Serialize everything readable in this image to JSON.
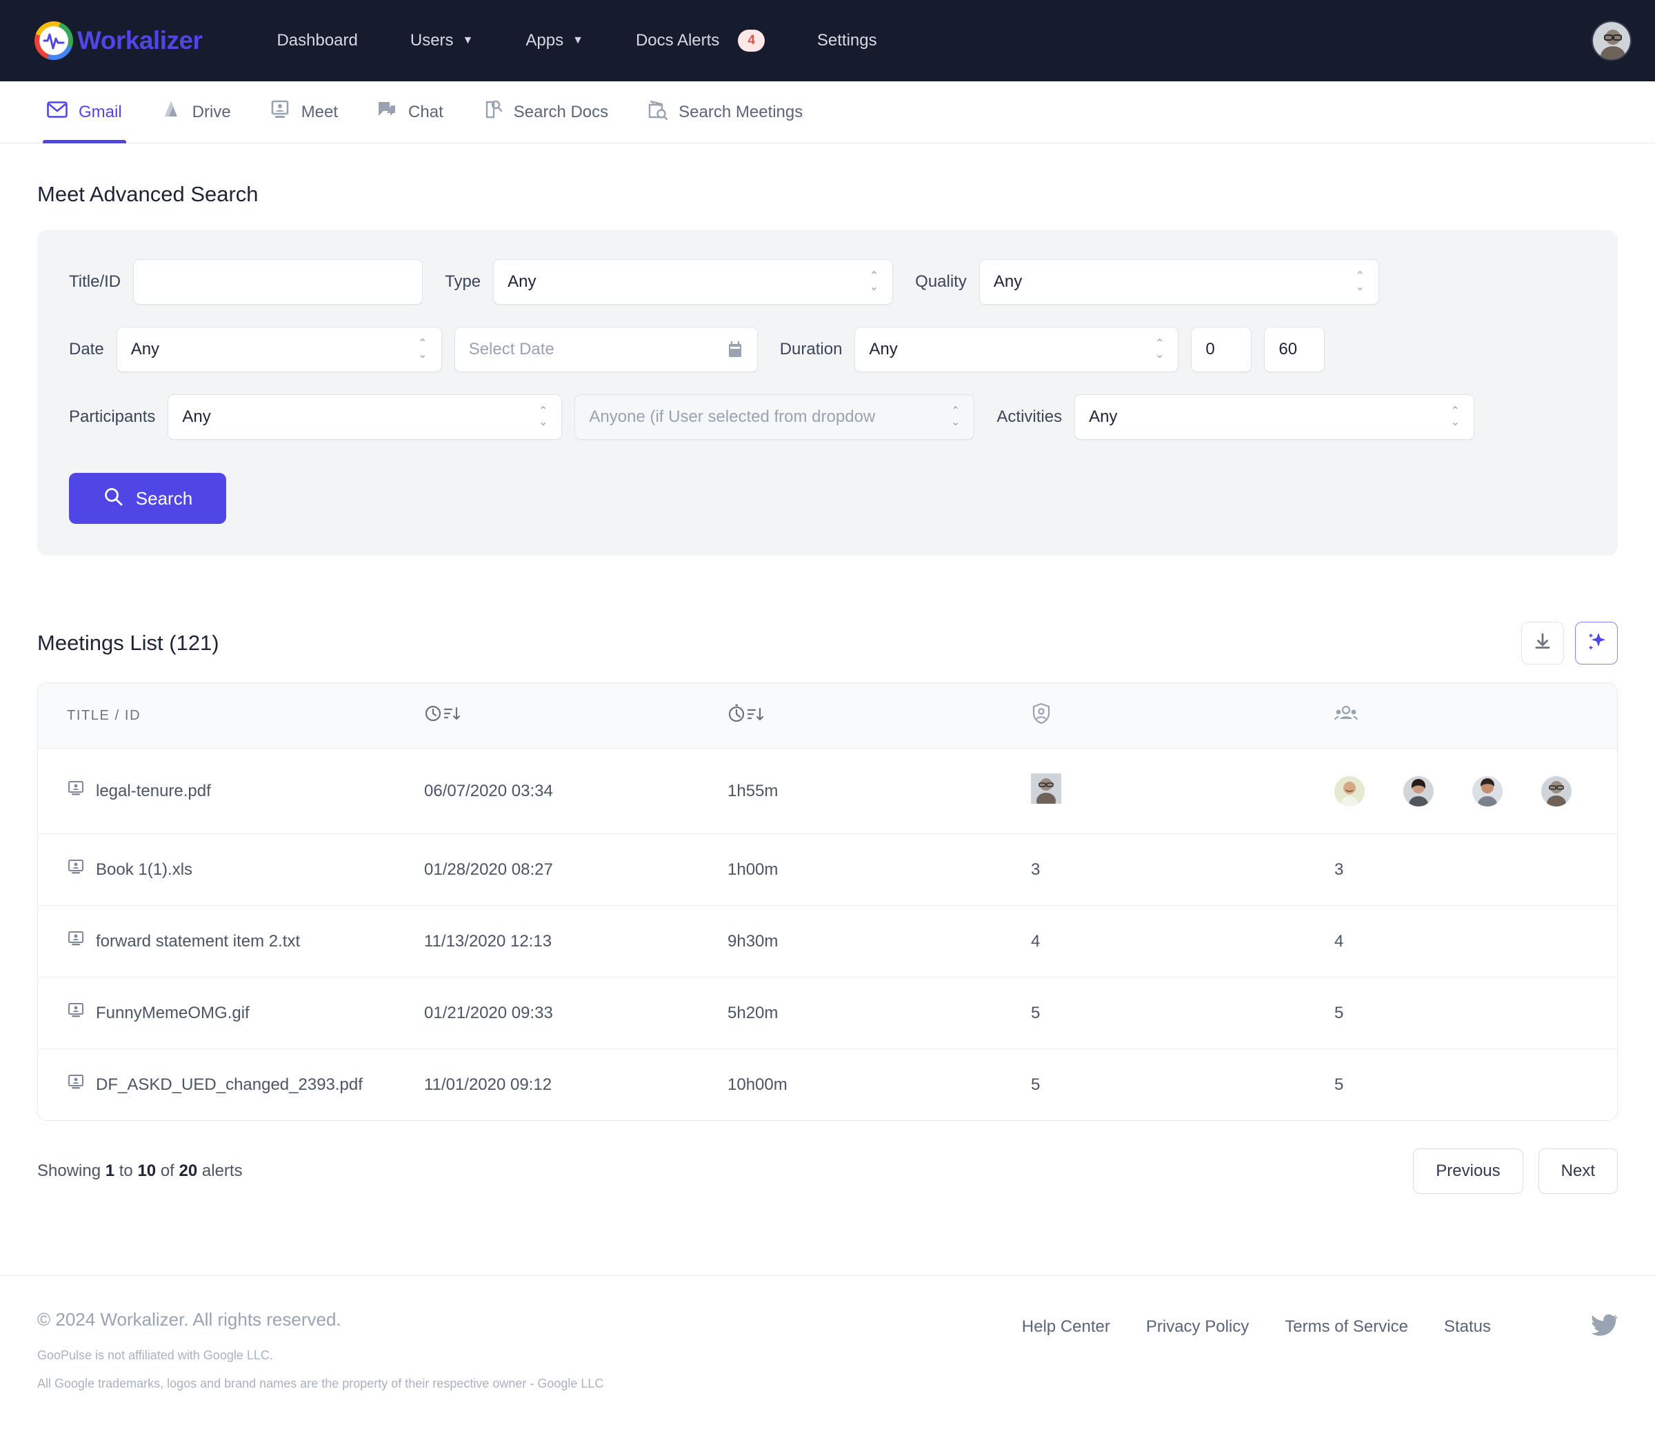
{
  "brand": {
    "name": "Workalizer",
    "logo_icon": "pulse-logo-icon"
  },
  "topnav": {
    "items": [
      {
        "label": "Dashboard",
        "caret": false
      },
      {
        "label": "Users",
        "caret": true
      },
      {
        "label": "Apps",
        "caret": true
      },
      {
        "label": "Docs Alerts",
        "caret": false,
        "badge": "4"
      },
      {
        "label": "Settings",
        "caret": false
      }
    ]
  },
  "tabs": [
    {
      "label": "Gmail",
      "icon": "gmail-icon",
      "active": true
    },
    {
      "label": "Drive",
      "icon": "drive-icon",
      "active": false
    },
    {
      "label": "Meet",
      "icon": "meet-icon",
      "active": false
    },
    {
      "label": "Chat",
      "icon": "chat-icon",
      "active": false
    },
    {
      "label": "Search Docs",
      "icon": "search-docs-icon",
      "active": false
    },
    {
      "label": "Search Meetings",
      "icon": "search-meetings-icon",
      "active": false
    }
  ],
  "page": {
    "title": "Meet Advanced Search"
  },
  "form": {
    "title_id": {
      "label": "Title/ID",
      "value": "",
      "placeholder": ""
    },
    "type": {
      "label": "Type",
      "value": "Any"
    },
    "quality": {
      "label": "Quality",
      "value": "Any"
    },
    "date": {
      "label": "Date",
      "value": "Any"
    },
    "date_picker": {
      "placeholder": "Select Date",
      "value": "",
      "icon": "calendar-icon"
    },
    "duration": {
      "label": "Duration",
      "value": "Any"
    },
    "duration_min": {
      "value": "0"
    },
    "duration_max": {
      "value": "60"
    },
    "participants": {
      "label": "Participants",
      "value": "Any"
    },
    "participant_user": {
      "label": "Anyone (if User selected from dropdow",
      "disabled": true
    },
    "activities": {
      "label": "Activities",
      "value": "Any"
    },
    "search_button": {
      "label": "Search",
      "icon": "search-icon",
      "color": "#4f46e5"
    }
  },
  "list": {
    "title": "Meetings List (121)",
    "export_icon": "download-icon",
    "ai_icon": "sparkles-icon",
    "columns": [
      {
        "label": "TITLE / ID",
        "icon": ""
      },
      {
        "label": "",
        "icon": "clock-sort-icon"
      },
      {
        "label": "",
        "icon": "stopwatch-sort-icon"
      },
      {
        "label": "",
        "icon": "organizer-shield-icon"
      },
      {
        "label": "",
        "icon": "participants-group-icon"
      }
    ],
    "rows": [
      {
        "title": "legal-tenure.pdf",
        "date": "06/07/2020 03:34",
        "duration": "1h55m",
        "organizer": "avatar",
        "participants": "avatars"
      },
      {
        "title": "Book 1(1).xls",
        "date": "01/28/2020 08:27",
        "duration": "1h00m",
        "organizer": "3",
        "participants": "3"
      },
      {
        "title": "forward statement item 2.txt",
        "date": "11/13/2020 12:13",
        "duration": "9h30m",
        "organizer": "4",
        "participants": "4"
      },
      {
        "title": "FunnyMemeOMG.gif",
        "date": "01/21/2020 09:33",
        "duration": "5h20m",
        "organizer": "5",
        "participants": "5"
      },
      {
        "title": "DF_ASKD_UED_changed_2393.pdf",
        "date": "11/01/2020 09:12",
        "duration": "10h00m",
        "organizer": "5",
        "participants": "5"
      }
    ],
    "row_icon": "meet-screen-icon"
  },
  "pagination": {
    "prefix": "Showing ",
    "from": "1",
    "mid": " to ",
    "to": "10",
    "mid2": " of ",
    "total": "20",
    "suffix": " alerts",
    "previous_label": "Previous",
    "next_label": "Next"
  },
  "footer": {
    "copyright": "© 2024 Workalizer. All rights reserved.",
    "disclaimer1": "GooPulse is not affiliated with Google LLC.",
    "disclaimer2": "All Google trademarks, logos and brand names are the property of their respective owner - Google LLC",
    "links": [
      "Help Center",
      "Privacy Policy",
      "Terms of Service",
      "Status"
    ],
    "social_icon": "twitter-icon"
  }
}
